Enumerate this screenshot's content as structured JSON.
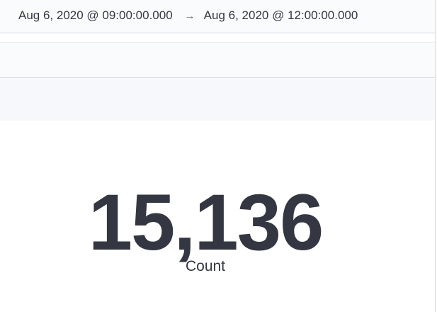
{
  "time_picker": {
    "start": "Aug 6, 2020 @ 09:00:00.000",
    "arrow_icon": "arrow-right-icon",
    "end": "Aug 6, 2020 @ 12:00:00.000"
  },
  "metric_panel": {
    "value": "15,136",
    "label": "Count"
  }
}
